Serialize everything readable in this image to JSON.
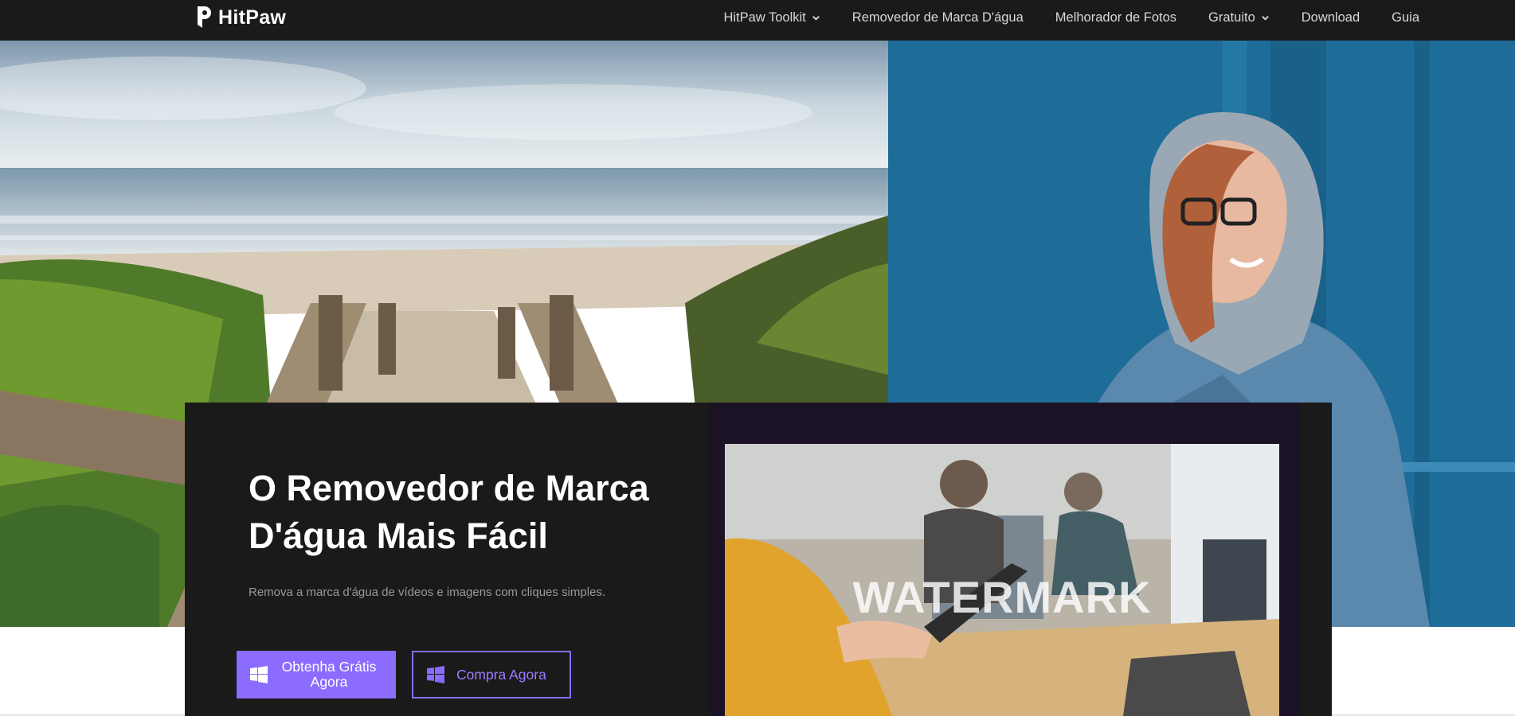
{
  "brand": {
    "name": "HitPaw"
  },
  "nav": {
    "items": [
      {
        "label": "HitPaw Toolkit",
        "has_dropdown": true
      },
      {
        "label": "Removedor de Marca D'água",
        "has_dropdown": false
      },
      {
        "label": "Melhorador de Fotos",
        "has_dropdown": false
      },
      {
        "label": "Gratuito",
        "has_dropdown": true
      },
      {
        "label": "Download",
        "has_dropdown": false
      },
      {
        "label": "Guia",
        "has_dropdown": false
      }
    ]
  },
  "hero": {
    "title": "O Removedor de Marca D'água Mais Fácil",
    "subtitle": "Remova a marca d'água de vídeos e imagens com cliques simples.",
    "primary_button": "Obtenha Grátis Agora",
    "secondary_button": "Compra Agora",
    "watermark_text": "WATERMARK"
  },
  "colors": {
    "nav_bg": "#1a1a1a",
    "card_bg": "#1a1a1a",
    "accent": "#8b6cff",
    "media_bg": "#1c1226"
  },
  "icons": [
    "hitpaw-logo-icon",
    "chevron-down-icon",
    "windows-icon"
  ]
}
